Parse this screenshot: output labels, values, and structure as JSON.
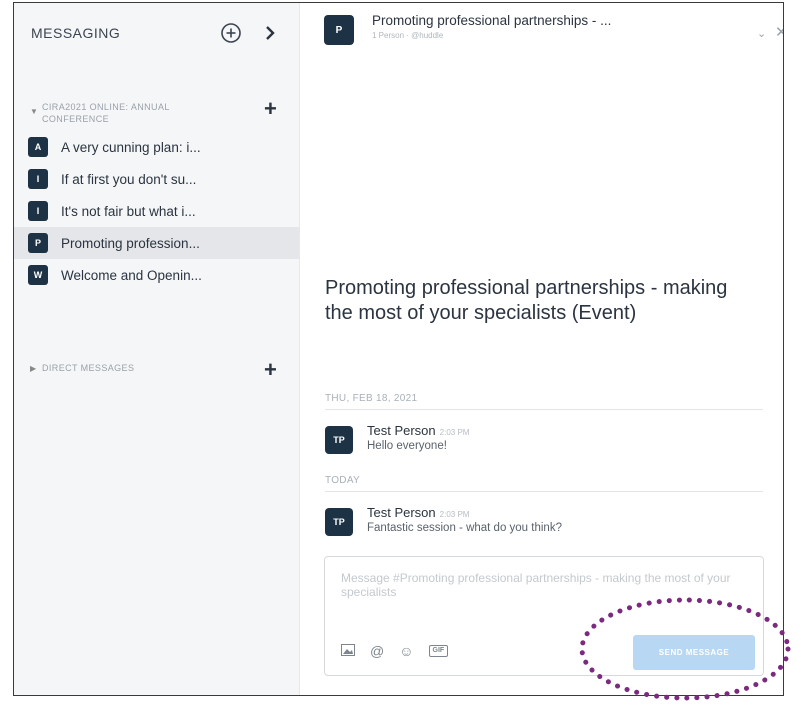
{
  "sidebar": {
    "title": "MESSAGING",
    "new_message_icon": "plus-circle-icon",
    "collapse_icon": "chevron-right-icon",
    "channel_section": {
      "label": "CIRA2021 ONLINE: ANNUAL CONFERENCE",
      "items": [
        {
          "badge": "A",
          "label": "A very cunning plan: i..."
        },
        {
          "badge": "I",
          "label": "If at first you don't su..."
        },
        {
          "badge": "I",
          "label": "It's not fair but what i..."
        },
        {
          "badge": "P",
          "label": "Promoting profession..."
        },
        {
          "badge": "W",
          "label": "Welcome and Openin..."
        }
      ]
    },
    "dm_section": {
      "label": "DIRECT MESSAGES"
    }
  },
  "header": {
    "badge": "P",
    "title": "Promoting professional partnerships - ...",
    "subtitle": "1 Person · @huddle"
  },
  "channel_intro": "Promoting professional partnerships - making the most of your specialists (Event)",
  "messages": [
    {
      "date": "THU, FEB 18, 2021",
      "avatar": "TP",
      "author": "Test Person",
      "time": "2:03 PM",
      "text": "Hello everyone!"
    },
    {
      "date": "TODAY",
      "avatar": "TP",
      "author": "Test Person",
      "time": "2:03 PM",
      "text": "Fantastic session - what do you think?"
    }
  ],
  "composer": {
    "placeholder": "Message #Promoting professional partnerships - making the most of your specialists",
    "send_label": "SEND MESSAGE"
  },
  "colors": {
    "badge": "#1e3245",
    "send_button": "#b8d7f2",
    "highlight": "#7b2a7f"
  }
}
